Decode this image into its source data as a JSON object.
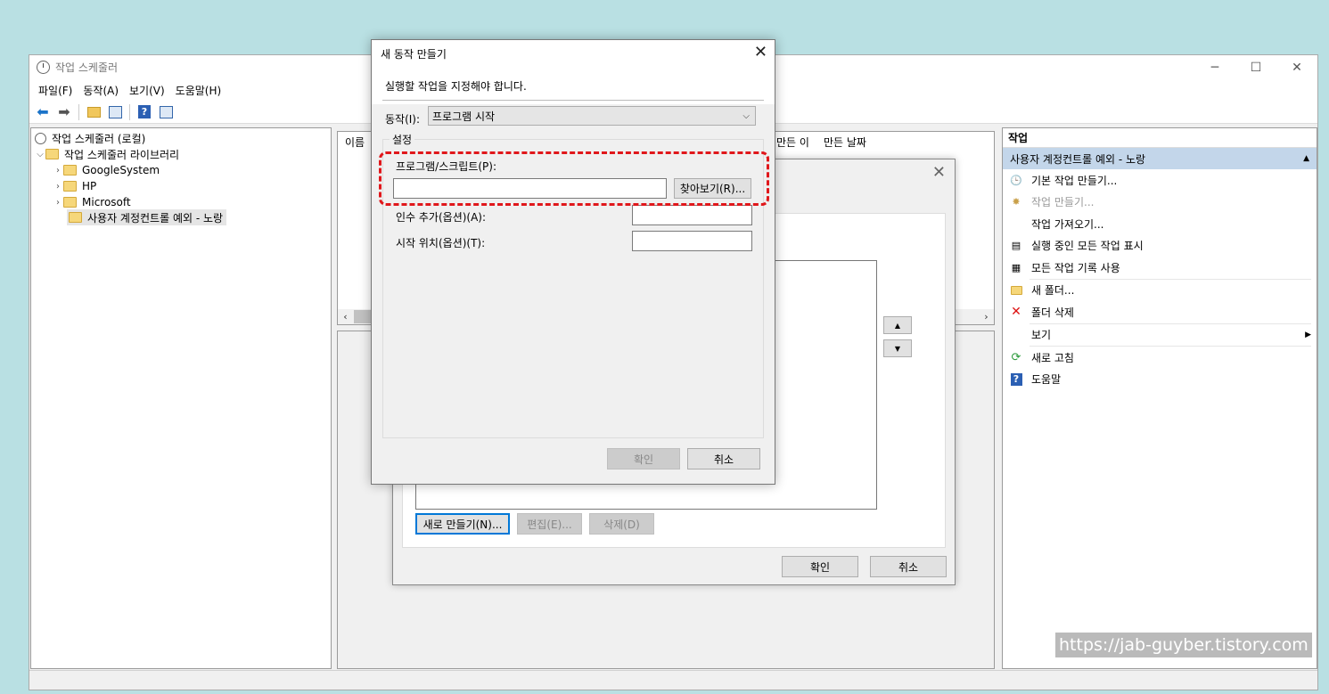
{
  "main_window": {
    "title": "작업 스케줄러",
    "controls": {
      "minimize": "─",
      "maximize": "☐",
      "close": "✕"
    },
    "menu": [
      "파일(F)",
      "동작(A)",
      "보기(V)",
      "도움말(H)"
    ]
  },
  "tree": {
    "root": "작업 스케줄러 (로컬)",
    "library": "작업 스케줄러 라이브러리",
    "folders": [
      "GoogleSystem",
      "HP",
      "Microsoft",
      "사용자 계정컨트롤 예외 - 노랑"
    ]
  },
  "task_list": {
    "columns": [
      "이름",
      "만든 이",
      "만든 날짜"
    ]
  },
  "actions": {
    "header": "작업",
    "section": "사용자 계정컨트롤 예외 - 노랑",
    "items": [
      "기본 작업 만들기...",
      "작업 만들기...",
      "작업 가져오기...",
      "실행 중인 모든 작업 표시",
      "모든 작업 기록 사용",
      "새 폴더...",
      "폴더 삭제",
      "보기",
      "새로 고침",
      "도움말"
    ]
  },
  "background_dialog": {
    "buttons": {
      "new": "새로 만들기(N)...",
      "edit": "편집(E)...",
      "delete": "삭제(D)",
      "ok": "확인",
      "cancel": "취소"
    }
  },
  "new_action_dialog": {
    "title": "새 동작 만들기",
    "instruction": "실행할 작업을 지정해야 합니다.",
    "action_label": "동작(I):",
    "action_value": "프로그램 시작",
    "settings_label": "설정",
    "program_label": "프로그램/스크립트(P):",
    "program_value": "",
    "browse_button": "찾아보기(R)...",
    "args_label": "인수 추가(옵션)(A):",
    "args_value": "",
    "start_in_label": "시작 위치(옵션)(T):",
    "start_in_value": "",
    "ok_button": "확인",
    "cancel_button": "취소"
  },
  "watermark": "https://jab-guyber.tistory.com",
  "colors": {
    "desktop": "#b9e0e3",
    "highlight": "#e0171b",
    "selection": "#c3d6ea"
  }
}
